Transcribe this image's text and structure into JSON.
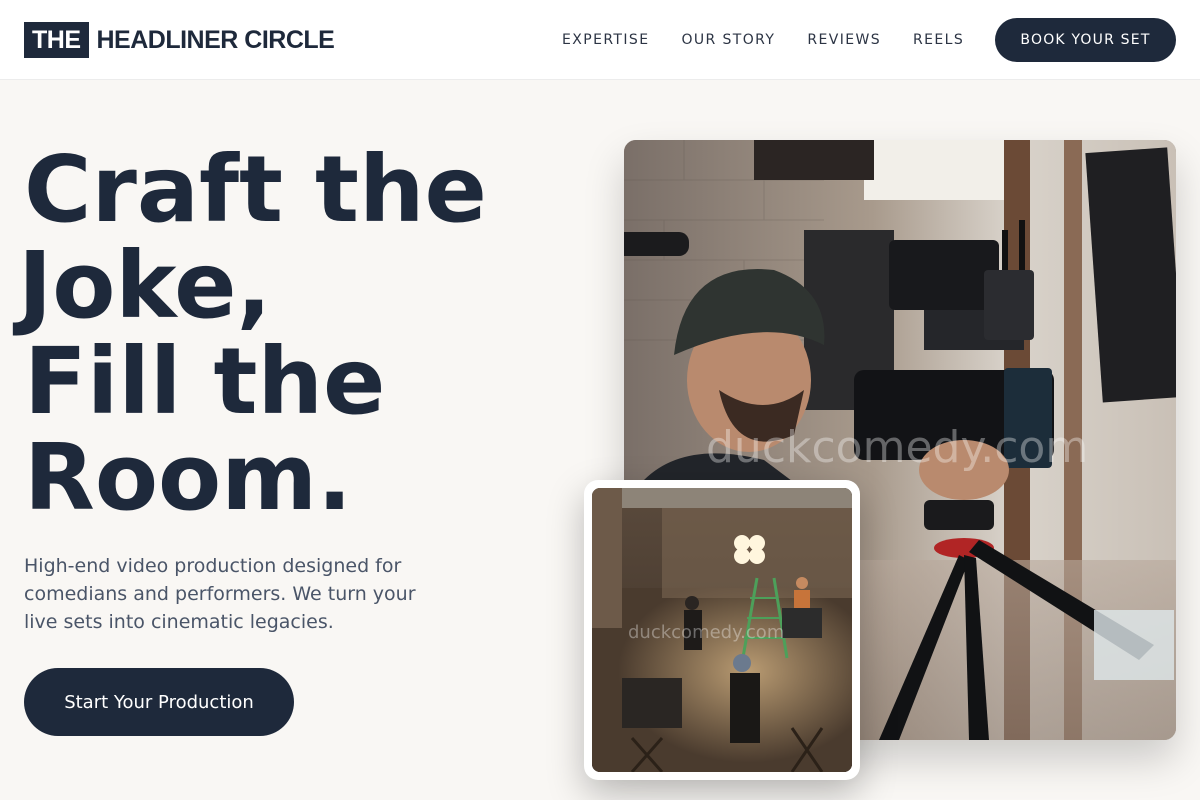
{
  "header": {
    "logo_box": "THE",
    "logo_text": "HEADLINER CIRCLE",
    "nav": [
      "EXPERTISE",
      "OUR STORY",
      "REVIEWS",
      "REELS"
    ],
    "book_button": "BOOK YOUR SET"
  },
  "hero": {
    "headline_lines": [
      "Craft the",
      "Joke,",
      "Fill the",
      "Room."
    ],
    "subtext": "High-end video production designed for comedians and performers. We turn your live sets into cinematic legacies.",
    "cta": "Start Your Production"
  },
  "images": {
    "main_watermark": "duckcomedy.com",
    "small_watermark": "duckcomedy.com"
  },
  "colors": {
    "primary": "#1e293b",
    "background": "#f9f7f4",
    "body_text": "#4a5568"
  }
}
